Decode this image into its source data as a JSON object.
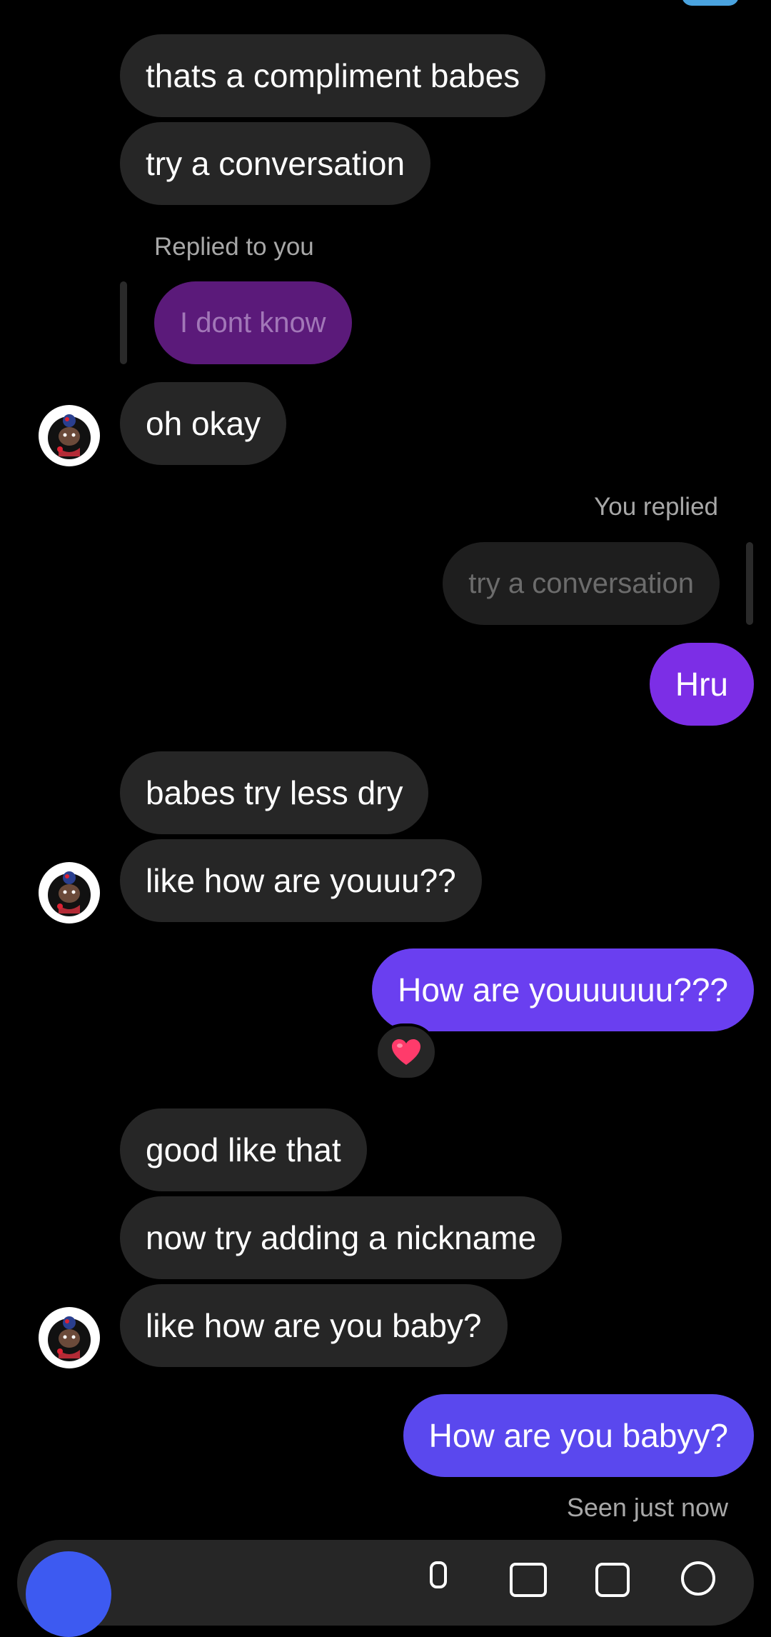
{
  "messages": {
    "m1": "thats a compliment babes",
    "m2": "try a conversation",
    "reply_label_1": "Replied to you",
    "quoted_1": "I dont know",
    "m3": "oh okay",
    "reply_label_2": "You replied",
    "quoted_2": "try a conversation",
    "s1": "Hru",
    "m4": "babes try less dry",
    "m5": "like how are youuu??",
    "s2": "How are youuuuuu???",
    "reaction": "❤️",
    "m6": "good like that",
    "m7": "now try adding a nickname",
    "m8": "like how are you baby?",
    "s3": "How are you babyy?",
    "seen": "Seen just now"
  },
  "colors": {
    "received_bubble": "#262626",
    "quoted_purple": "#5b1a7a",
    "sent_1": "#7c2ee6",
    "sent_2": "#6a3ff0",
    "sent_3": "#5a48ee",
    "background": "#000000"
  }
}
